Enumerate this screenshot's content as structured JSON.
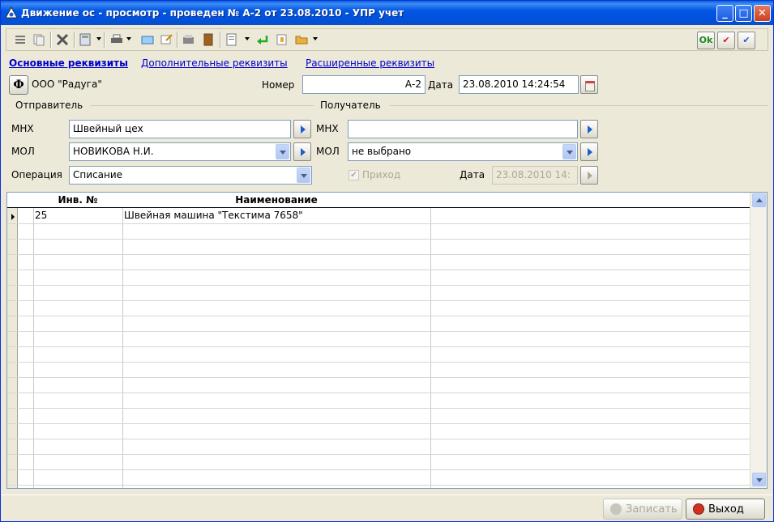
{
  "window": {
    "title": "Движение ос - просмотр - проведен № А-2 от 23.08.2010 - УПР учет",
    "minimize": "_",
    "maximize": "□",
    "close": "✕"
  },
  "toolbar": {
    "icons": [
      "list-icon",
      "copy-icon",
      "delete-icon",
      "calculator-icon",
      "print-icon",
      "mail-icon",
      "edit-icon",
      "report-icon",
      "book-icon",
      "document-icon",
      "enter-icon",
      "properties-icon",
      "folder-icon"
    ],
    "ok_label": "Ok",
    "check_red": "✔",
    "check_blue": "✔"
  },
  "tabs": [
    {
      "label": "Основные реквизиты",
      "active": true
    },
    {
      "label": "Дополнительные реквизиты",
      "active": false
    },
    {
      "label": "Расширенные реквизиты",
      "active": false
    }
  ],
  "header": {
    "f_button": "Ф",
    "org": "ООО \"Радуга\"",
    "number_label": "Номер",
    "number_value": "А-2",
    "date_label": "Дата",
    "date_value": "23.08.2010 14:24:54"
  },
  "sender": {
    "group_label": "Отправитель",
    "mhx_label": "МНХ",
    "mhx_value": "Швейный цех",
    "mol_label": "МОЛ",
    "mol_value": "НОВИКОВА Н.И.",
    "operation_label": "Операция",
    "operation_value": "Списание"
  },
  "receiver": {
    "group_label": "Получатель",
    "mhx_label": "МНХ",
    "mhx_value": "",
    "mol_label": "МОЛ",
    "mol_value": "не выбрано",
    "income_label": "Приход",
    "income_checked": true,
    "date_label": "Дата",
    "date_value": "23.08.2010 14:"
  },
  "grid": {
    "columns": [
      "Инв. №",
      "Наименование",
      ""
    ],
    "rows": [
      {
        "inv": "25",
        "name": "Швейная машина \"Текстима 7658\""
      }
    ]
  },
  "footer": {
    "save_label": "Записать",
    "exit_label": "Выход"
  }
}
